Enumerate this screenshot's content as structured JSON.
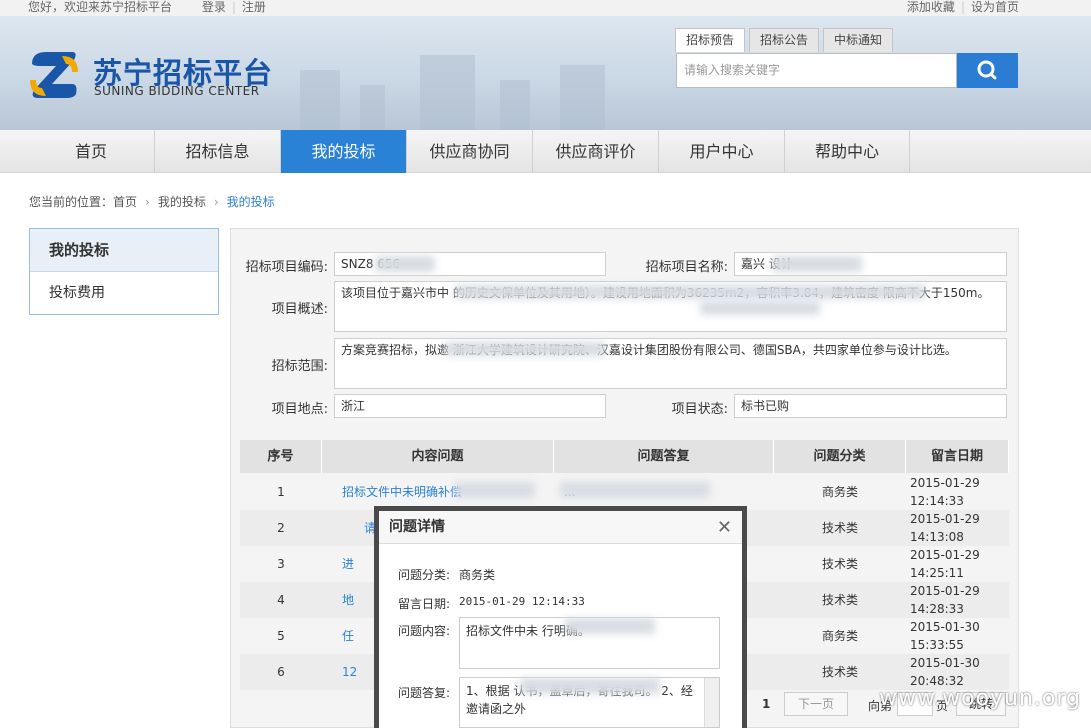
{
  "topbar": {
    "greeting": "您好，欢迎来苏宁招标平台",
    "login": "登录",
    "register": "注册",
    "favorite": "添加收藏",
    "homepage": "设为首页"
  },
  "logo": {
    "cn": "苏宁招标平台",
    "en": "SUNING BIDDING CENTER"
  },
  "search": {
    "tabs": [
      "招标预告",
      "招标公告",
      "中标通知"
    ],
    "placeholder": "请输入搜索关键字"
  },
  "nav": [
    "首页",
    "招标信息",
    "我的投标",
    "供应商协同",
    "供应商评价",
    "用户中心",
    "帮助中心"
  ],
  "breadcrumb": {
    "prefix": "您当前的位置：",
    "items": [
      "首页",
      "我的投标",
      "我的投标"
    ]
  },
  "sidebar": {
    "title": "我的投标",
    "items": [
      "投标费用"
    ]
  },
  "project": {
    "code_label": "招标项目编码:",
    "code_value": "SNZ8            656",
    "name_label": "招标项目名称:",
    "name_value": "嘉兴                设计",
    "summary_label": "项目概述:",
    "summary_value": "该项目位于嘉兴市中                                                                                  的历史文保单位及其用地）。建设用地面积为36235m2，容积率3.84，建筑密度                      限高不大于150m。",
    "scope_label": "招标范围:",
    "scope_value": "方案竞赛招标，拟邀                                                  浙江大学建筑设计研究院、汉嘉设计集团股份有限公司、德国SBA，共四家单位参与设计比选。",
    "location_label": "项目地点:",
    "location_value": "浙江",
    "status_label": "项目状态:",
    "status_value": "标书已购"
  },
  "table": {
    "headers": [
      "序号",
      "内容问题",
      "问题答复",
      "问题分类",
      "留言日期"
    ],
    "rows": [
      {
        "no": "1",
        "question": "招标文件中未明确补偿",
        "answer": "                        ...",
        "category": "商务类",
        "date": "2015-01-29 12:14:33"
      },
      {
        "no": "2",
        "question": "请",
        "answer": "",
        "category": "技术类",
        "date": "2015-01-29 14:13:08"
      },
      {
        "no": "3",
        "question": "进",
        "answer": "",
        "category": "技术类",
        "date": "2015-01-29 14:25:11"
      },
      {
        "no": "4",
        "question": "地",
        "answer": "",
        "category": "技术类",
        "date": "2015-01-29 14:28:33"
      },
      {
        "no": "5",
        "question": "任",
        "answer": "",
        "category": "商务类",
        "date": "2015-01-30 15:33:55"
      },
      {
        "no": "6",
        "question": "12",
        "answer": "",
        "category": "技术类",
        "date": "2015-01-30 20:48:32"
      }
    ]
  },
  "pager": {
    "current": "1",
    "next": "下一页",
    "goto": "向第",
    "page": "页",
    "confirm": "跳转"
  },
  "modal": {
    "title": "问题详情",
    "category_label": "问题分类:",
    "category_value": "商务类",
    "date_label": "留言日期:",
    "date_value": "2015-01-29 12:14:33",
    "content_label": "问题内容:",
    "content_value": "招标文件中未            行明确。",
    "answer_label": "问题答复:",
    "answer_value": "1、根据                                认书，盖章后，寄往我司。 2、经邀请函之外"
  },
  "watermark": "www.wooyun.org"
}
